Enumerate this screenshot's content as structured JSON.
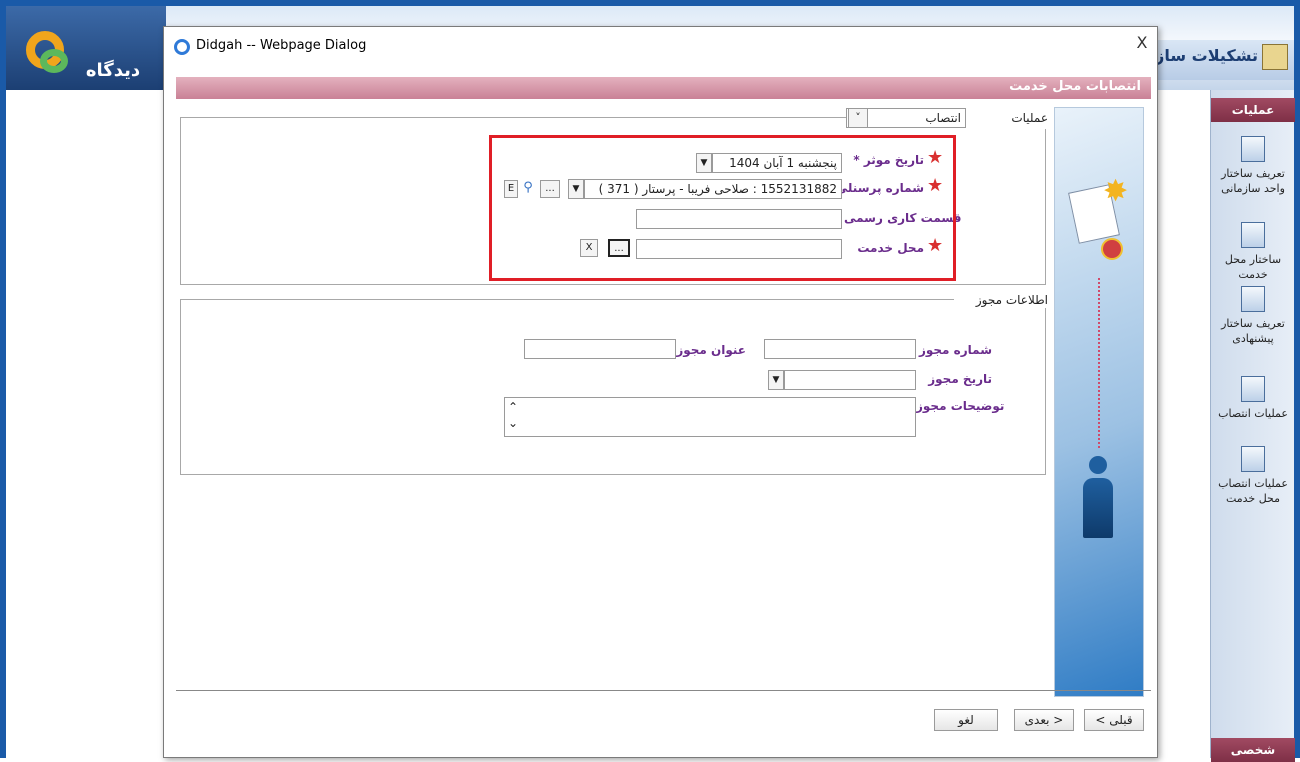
{
  "app": {
    "logo_text": "دیدگاه",
    "header_title": "تشکیلات سازمانی"
  },
  "sidebar": {
    "section_title": "عملیات",
    "items": [
      {
        "label": "تعریف ساختار واحد سازمانی",
        "icon": "building-icon"
      },
      {
        "label": "ساختار محل خدمت",
        "icon": "org-chart-icon"
      },
      {
        "label": "تعریف ساختار پیشنهادی",
        "icon": "proposal-structure-icon"
      },
      {
        "label": "عملیات انتصاب",
        "icon": "appointment-icon"
      },
      {
        "label": "عملیات انتصاب محل خدمت",
        "icon": "appointment-location-icon"
      }
    ],
    "bottom_section_title": "شخصی"
  },
  "dialog": {
    "title": "Didgah -- Webpage Dialog",
    "close_label": "X",
    "band_title": "انتصابات محل خدمت",
    "operation_group": {
      "legend": "عملیات",
      "operation_value": "انتصاب",
      "fields": {
        "effective_date_label": "* تاریخ موثر",
        "effective_date_value": "پنجشنبه 1 آبان 1404",
        "personnel_number_label": "شماره پرسنلی",
        "personnel_number_value": "1552131882 : صلاحی فریبا - پرستار ( 371 )",
        "official_department_label": "قسمت کاری رسمی",
        "official_department_value": "",
        "service_location_label": "محل خدمت",
        "service_location_value": ""
      },
      "buttons": {
        "ellipsis": "...",
        "e_button": "E",
        "clear_button": "X"
      }
    },
    "license_group": {
      "legend": "اطلاعات مجوز",
      "license_number_label": "شماره مجوز",
      "license_title_label": "عنوان مجوز",
      "license_date_label": "تاریخ مجوز",
      "license_desc_label": "توضیحات مجوز"
    },
    "footer": {
      "prev_label": "< قبلی",
      "next_label": "بعدی >",
      "cancel_label": "لغو"
    }
  },
  "colors": {
    "frame_blue": "#1a5aa8",
    "band_pink": "#c98196",
    "label_purple": "#6a2c8c",
    "highlight_red": "#e01e26"
  }
}
